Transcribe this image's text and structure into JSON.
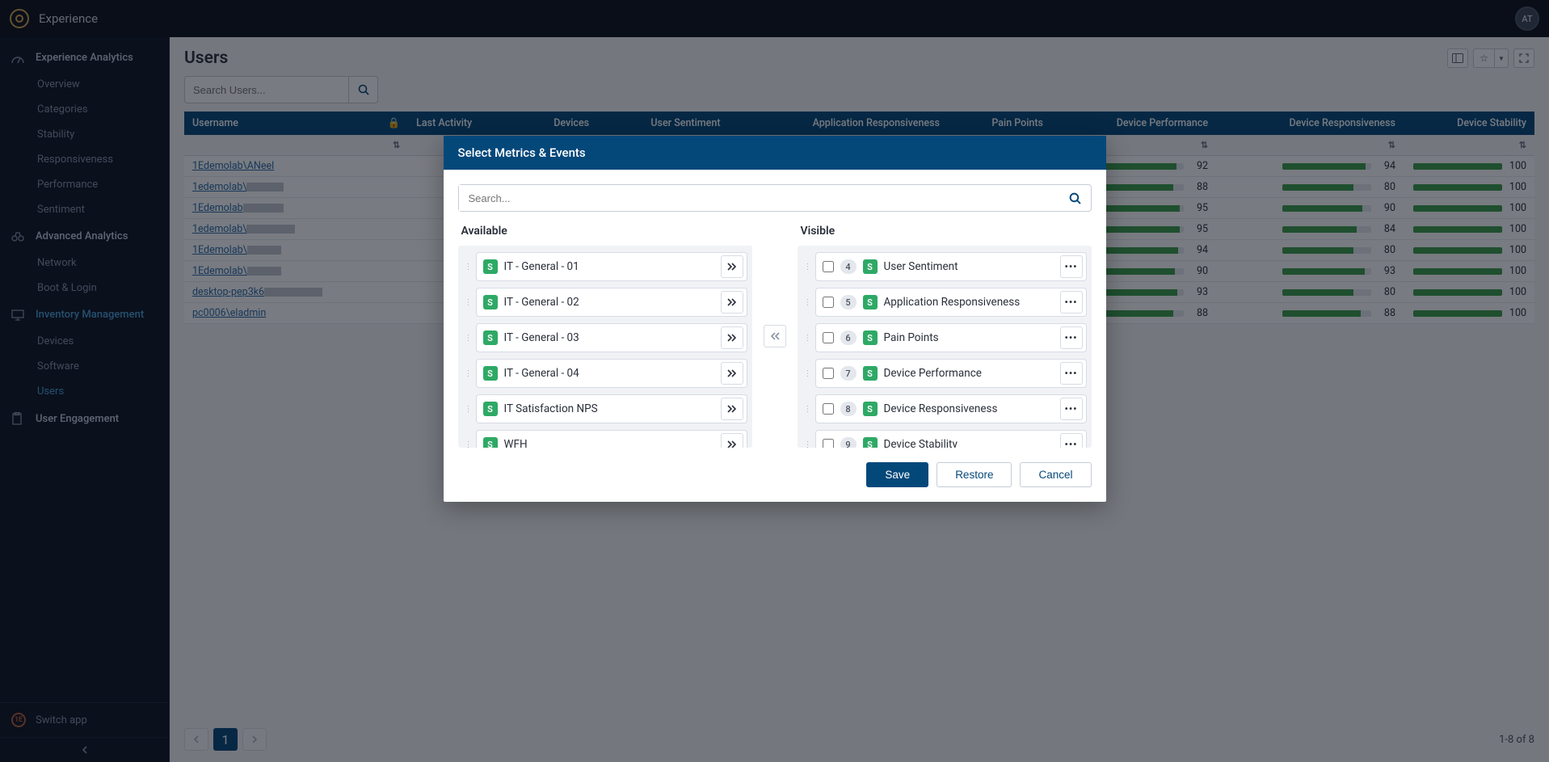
{
  "app_name": "Experience",
  "avatar_initials": "AT",
  "sidebar": {
    "sections": [
      {
        "label": "Experience Analytics",
        "icon": "dashboard-icon",
        "items": [
          {
            "label": "Overview"
          },
          {
            "label": "Categories"
          },
          {
            "label": "Stability"
          },
          {
            "label": "Responsiveness"
          },
          {
            "label": "Performance"
          },
          {
            "label": "Sentiment"
          }
        ]
      },
      {
        "label": "Advanced Analytics",
        "icon": "binocular-icon",
        "items": [
          {
            "label": "Network"
          },
          {
            "label": "Boot & Login"
          }
        ]
      },
      {
        "label": "Inventory Management",
        "icon": "monitor-icon",
        "highlight": true,
        "items": [
          {
            "label": "Devices"
          },
          {
            "label": "Software"
          },
          {
            "label": "Users",
            "active": true
          }
        ]
      },
      {
        "label": "User Engagement",
        "icon": "clipboard-icon",
        "items": []
      }
    ],
    "switch_app": "Switch app"
  },
  "page": {
    "title": "Users",
    "search_placeholder": "Search Users..."
  },
  "table": {
    "columns": [
      "Username",
      "Last Activity",
      "Devices",
      "User Sentiment",
      "Application Responsiveness",
      "Pain Points",
      "Device Performance",
      "Device Responsiveness",
      "Device Stability"
    ],
    "rows": [
      {
        "user": "1Edemolab\\ANeel",
        "dp": 92,
        "dr": 94,
        "ds": 100
      },
      {
        "user": "1edemolab\\",
        "dp": 88,
        "dr": 80,
        "ds": 100
      },
      {
        "user": "1Edemolab",
        "dp": 95,
        "dr": 90,
        "ds": 100
      },
      {
        "user": "1edemolab\\",
        "dp": 95,
        "dr": 84,
        "ds": 100
      },
      {
        "user": "1Edemolab\\",
        "dp": 94,
        "dr": 80,
        "ds": 100
      },
      {
        "user": "1Edemolab\\",
        "dp": 90,
        "dr": 93,
        "ds": 100
      },
      {
        "user": "desktop-pep3k6",
        "dp": 93,
        "dr": 80,
        "ds": 100
      },
      {
        "user": "pc0006\\eladmin",
        "dp": 88,
        "dr": 88,
        "ds": 100
      }
    ]
  },
  "pagination": {
    "current": "1",
    "info": "1-8 of 8"
  },
  "modal": {
    "title": "Select Metrics & Events",
    "search_placeholder": "Search...",
    "available_label": "Available",
    "visible_label": "Visible",
    "available": [
      {
        "label": "IT - General - 01"
      },
      {
        "label": "IT - General - 02"
      },
      {
        "label": "IT - General - 03"
      },
      {
        "label": "IT - General - 04"
      },
      {
        "label": "IT Satisfaction NPS"
      },
      {
        "label": "WFH"
      }
    ],
    "visible": [
      {
        "order": "4",
        "label": "User Sentiment"
      },
      {
        "order": "5",
        "label": "Application Responsiveness"
      },
      {
        "order": "6",
        "label": "Pain Points"
      },
      {
        "order": "7",
        "label": "Device Performance"
      },
      {
        "order": "8",
        "label": "Device Responsiveness"
      },
      {
        "order": "9",
        "label": "Device Stability"
      }
    ],
    "buttons": {
      "save": "Save",
      "restore": "Restore",
      "cancel": "Cancel"
    }
  }
}
